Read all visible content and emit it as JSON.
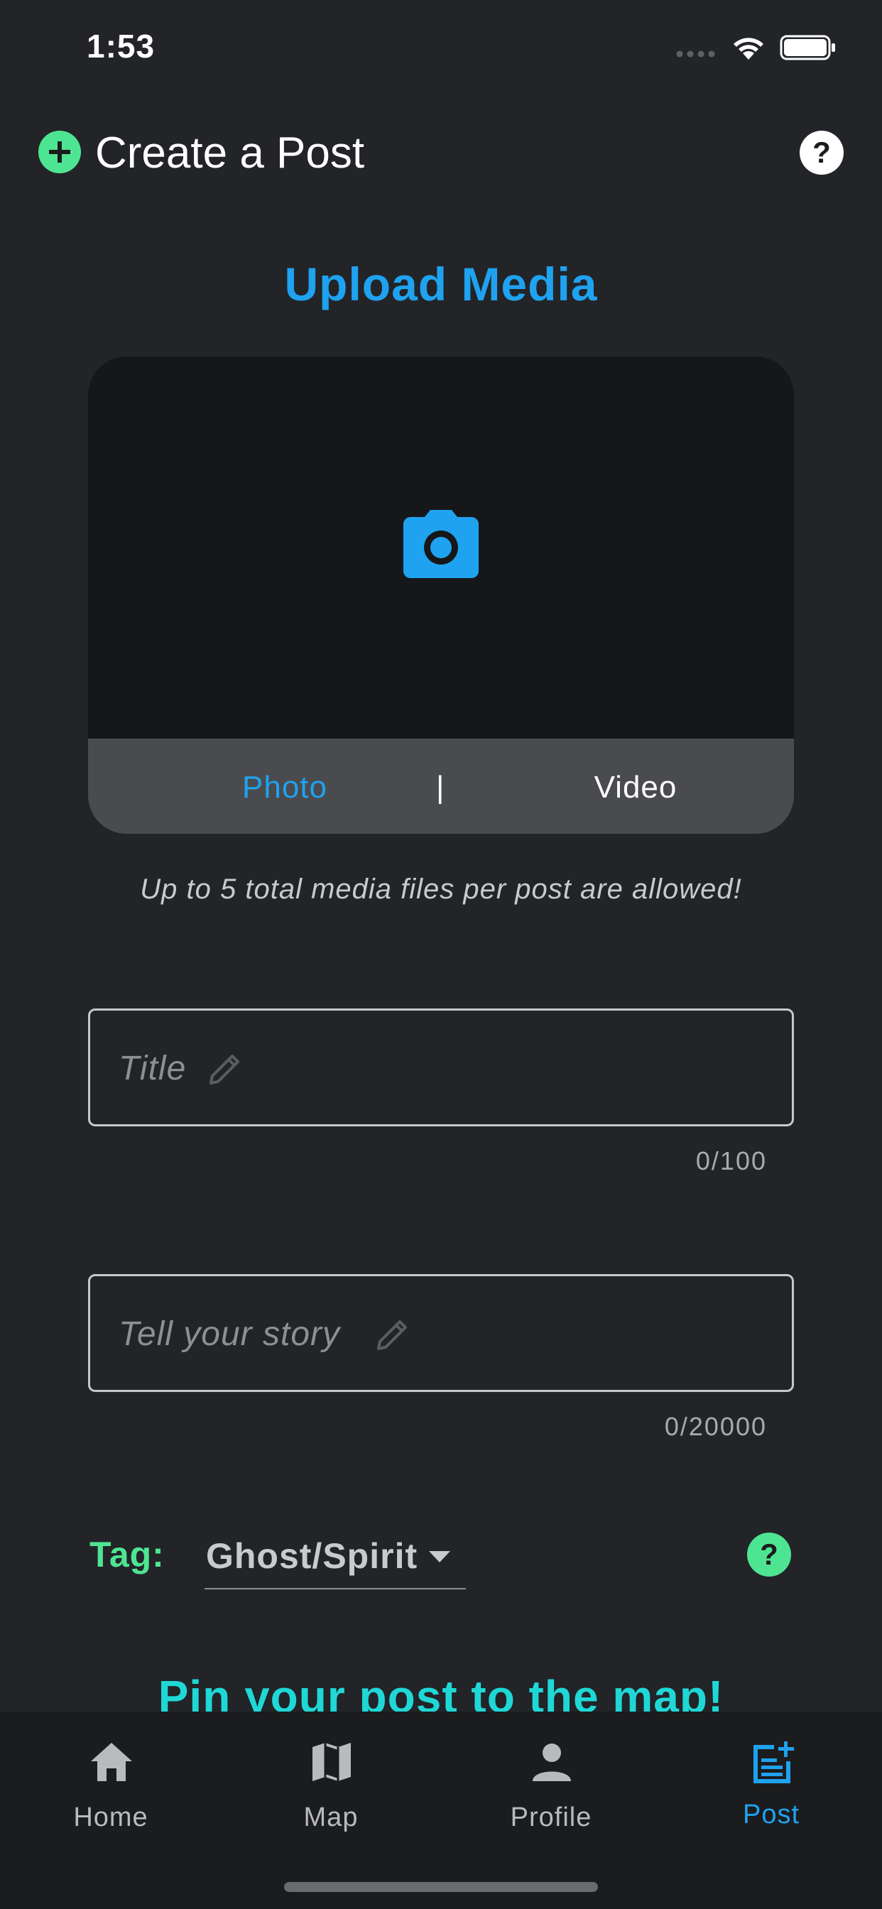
{
  "status_bar": {
    "time": "1:53"
  },
  "header": {
    "title": "Create a Post"
  },
  "upload": {
    "title": "Upload Media",
    "tab_photo": "Photo",
    "tab_divider": "|",
    "tab_video": "Video",
    "note": "Up to 5 total media files per post are allowed!"
  },
  "form": {
    "title_placeholder": "Title",
    "title_counter": "0/100",
    "story_placeholder": "Tell your story",
    "story_counter": "0/20000",
    "tag_label": "Tag:",
    "tag_value": "Ghost/Spirit"
  },
  "pin": {
    "title": "Pin your post to the map!"
  },
  "nav": [
    {
      "label": "Home",
      "icon": "home-icon"
    },
    {
      "label": "Map",
      "icon": "map-icon"
    },
    {
      "label": "Profile",
      "icon": "person-icon"
    },
    {
      "label": "Post",
      "icon": "post-add-icon"
    }
  ],
  "colors": {
    "background": "#222428",
    "accent_blue": "#1fa2ef",
    "accent_green": "#4ee592",
    "accent_teal": "#1fd8d6"
  }
}
